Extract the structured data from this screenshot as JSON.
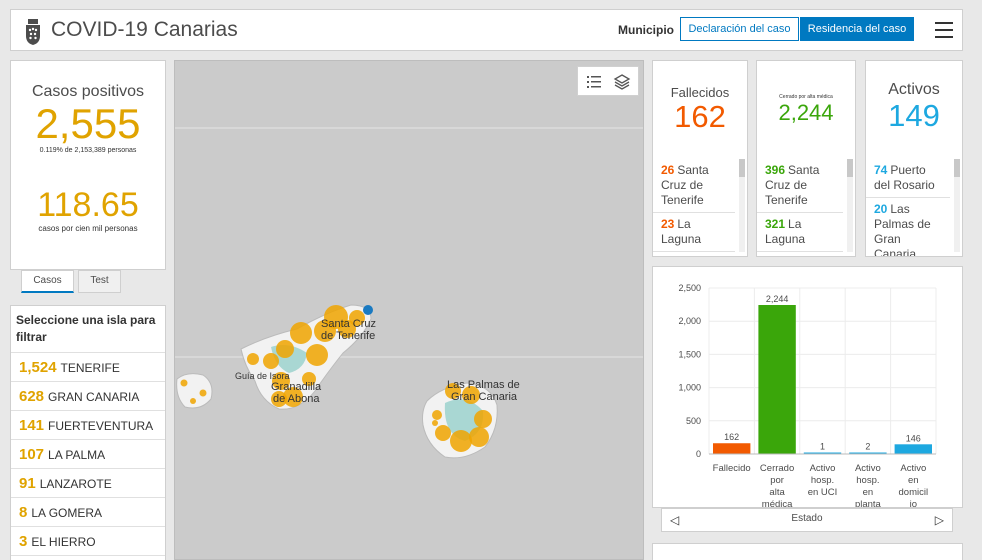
{
  "header": {
    "title": "COVID-19 Canarias",
    "municipio_label": "Municipio",
    "btn_declaracion": "Declaración del caso",
    "btn_residencia": "Residencia del caso"
  },
  "casos": {
    "title": "Casos positivos",
    "total": "2,555",
    "pct_note": "0.119% de 2,153,389 personas",
    "rate": "118.65",
    "rate_note": "casos por cien mil personas"
  },
  "tabs": {
    "casos": "Casos",
    "test": "Test"
  },
  "islands": {
    "header": "Seleccione una isla para filtrar",
    "items": [
      {
        "count": "1,524",
        "name": "TENERIFE"
      },
      {
        "count": "628",
        "name": "GRAN CANARIA"
      },
      {
        "count": "141",
        "name": "FUERTEVENTURA"
      },
      {
        "count": "107",
        "name": "LA PALMA"
      },
      {
        "count": "91",
        "name": "LANZAROTE"
      },
      {
        "count": "8",
        "name": "LA GOMERA"
      },
      {
        "count": "3",
        "name": "EL HIERRO"
      }
    ]
  },
  "map": {
    "labels": {
      "santa_cruz": "Santa Cruz de Tenerife",
      "guia": "Guía de Isora",
      "granadilla": "Granadilla de Abona",
      "las_palmas": "Las Palmas de Gran Canaria"
    }
  },
  "fallecidos": {
    "title": "Fallecidos",
    "value": "162",
    "color": "#f25a00",
    "items": [
      {
        "n": "26",
        "place": "Santa Cruz de Tenerife"
      },
      {
        "n": "23",
        "place": "La Laguna"
      }
    ]
  },
  "cerrados": {
    "title": "Cerrado por alta médica",
    "value": "2,244",
    "color": "#3aa60a",
    "items": [
      {
        "n": "396",
        "place": "Santa Cruz de Tenerife"
      },
      {
        "n": "321",
        "place": "La Laguna"
      }
    ]
  },
  "activos": {
    "title": "Activos",
    "value": "149",
    "color": "#1da8e0",
    "items": [
      {
        "n": "74",
        "place": "Puerto del Rosario"
      },
      {
        "n": "20",
        "place": "Las Palmas de Gran Canaria"
      }
    ]
  },
  "chart_data": {
    "type": "bar",
    "categories": [
      "Fallecido",
      "Cerrado por alta médica",
      "Activo hosp. en UCI",
      "Activo hosp. en planta",
      "Activo en domicilio"
    ],
    "tick_labels": [
      [
        "Fallecido"
      ],
      [
        "Cerrado",
        "por",
        "alta",
        "médica"
      ],
      [
        "Activo",
        "hosp.",
        "en UCI"
      ],
      [
        "Activo",
        "hosp.",
        "en",
        "planta"
      ],
      [
        "Activo",
        "en",
        "domicil",
        "io"
      ]
    ],
    "values": [
      162,
      2244,
      1,
      2,
      146
    ],
    "value_labels": [
      "162",
      "2,244",
      "1",
      "2",
      "146"
    ],
    "colors": [
      "#f25a00",
      "#3aa60a",
      "#1da8e0",
      "#1da8e0",
      "#1da8e0"
    ],
    "yticks": [
      0,
      500,
      1000,
      1500,
      2000,
      2500
    ],
    "ytick_labels": [
      "0",
      "500",
      "1,000",
      "1,500",
      "2,000",
      "2,500"
    ],
    "ylim": [
      0,
      2500
    ],
    "xlabel": "Estado",
    "ylabel": ""
  }
}
